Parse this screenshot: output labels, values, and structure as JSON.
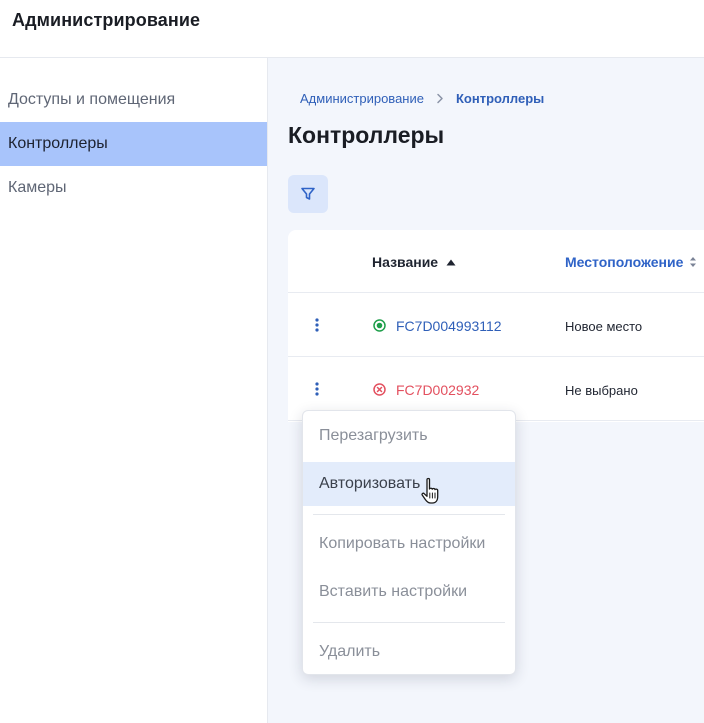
{
  "app": {
    "title": "Администрирование"
  },
  "sidebar": {
    "items": [
      {
        "label": "Доступы и помещения",
        "active": false
      },
      {
        "label": "Контроллеры",
        "active": true
      },
      {
        "label": "Камеры",
        "active": false
      }
    ]
  },
  "breadcrumb": {
    "parent": "Администрирование",
    "separator_icon": "chevron-right-icon",
    "current": "Контроллеры"
  },
  "page": {
    "title": "Контроллеры"
  },
  "toolbar": {
    "filter_icon": "filter-icon"
  },
  "table": {
    "columns": [
      {
        "label": "Название",
        "sort": "asc"
      },
      {
        "label": "Местоположение",
        "sort": "sortable"
      }
    ],
    "rows": [
      {
        "status": "online",
        "name": "FC7D004993112",
        "location": "Новое место"
      },
      {
        "status": "error",
        "name": "FC7D002932",
        "location": "Не выбрано"
      }
    ]
  },
  "context_menu": {
    "items": [
      {
        "label": "Перезагрузить",
        "state": "disabled"
      },
      {
        "label": "Авторизовать",
        "state": "hover"
      },
      {
        "label": "Копировать настройки",
        "state": "disabled"
      },
      {
        "label": "Вставить настройки",
        "state": "disabled"
      },
      {
        "label": "Удалить",
        "state": "disabled"
      }
    ]
  },
  "colors": {
    "accent": "#2f63c7",
    "sidebar_active": "#a8c4fb",
    "status_online": "#1e9e4a",
    "status_error": "#e3505f",
    "menu_hover": "#e3ecfb"
  }
}
